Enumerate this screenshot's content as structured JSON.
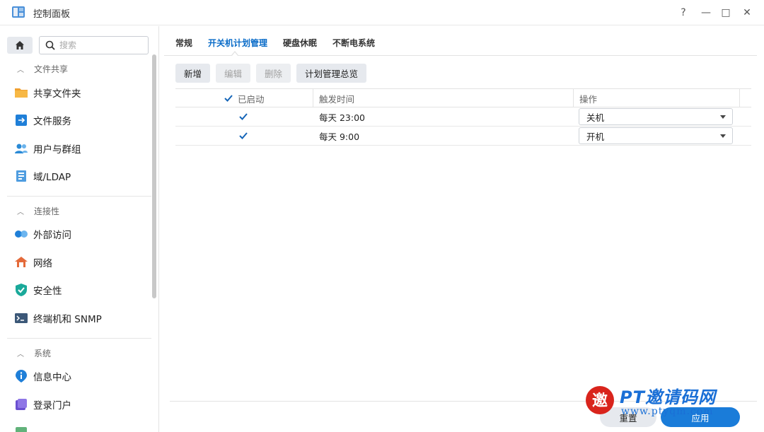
{
  "window": {
    "title": "控制面板",
    "controls": {
      "help": "?",
      "minimize": "—",
      "maximize": "□",
      "close": "✕"
    }
  },
  "sidebar": {
    "search_placeholder": "搜索",
    "sections": [
      {
        "title": "文件共享",
        "items": [
          {
            "label": "共享文件夹",
            "icon": "folder-icon"
          },
          {
            "label": "文件服务",
            "icon": "file-services-icon"
          },
          {
            "label": "用户与群组",
            "icon": "users-icon"
          },
          {
            "label": "域/LDAP",
            "icon": "domain-icon"
          }
        ]
      },
      {
        "title": "连接性",
        "items": [
          {
            "label": "外部访问",
            "icon": "external-access-icon"
          },
          {
            "label": "网络",
            "icon": "network-icon"
          },
          {
            "label": "安全性",
            "icon": "shield-icon"
          },
          {
            "label": "终端机和 SNMP",
            "icon": "terminal-icon"
          }
        ]
      },
      {
        "title": "系统",
        "items": [
          {
            "label": "信息中心",
            "icon": "info-icon"
          },
          {
            "label": "登录门户",
            "icon": "login-portal-icon"
          }
        ]
      }
    ]
  },
  "tabs": [
    {
      "label": "常规",
      "active": false
    },
    {
      "label": "开关机计划管理",
      "active": true
    },
    {
      "label": "硬盘休眠",
      "active": false
    },
    {
      "label": "不断电系统",
      "active": false
    }
  ],
  "toolbar": {
    "add": "新增",
    "edit": "编辑",
    "delete": "删除",
    "overview": "计划管理总览"
  },
  "table": {
    "columns": {
      "enabled": "已启动",
      "trigger_time": "触发时间",
      "action": "操作"
    },
    "rows": [
      {
        "enabled": true,
        "trigger_time": "每天 23:00",
        "action": "关机"
      },
      {
        "enabled": true,
        "trigger_time": "每天 9:00",
        "action": "开机"
      }
    ]
  },
  "footer": {
    "reset": "重置",
    "apply": "应用"
  },
  "watermark": {
    "brand": "PT邀请码网",
    "url": "www.ptyqm.com"
  },
  "colors": {
    "accent": "#1a7cd9",
    "tab_active": "#0a6cc8",
    "check": "#1565b8"
  }
}
